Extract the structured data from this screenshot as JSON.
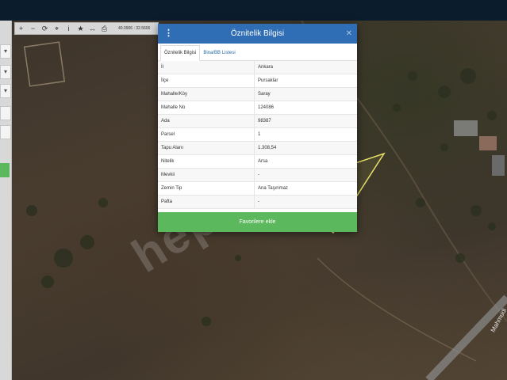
{
  "dialog": {
    "title": "Öznitelik Bilgisi",
    "tabs": [
      {
        "label": "Öznitelik Bilgisi",
        "active": true
      },
      {
        "label": "Bina/BB Listesi",
        "active": false
      }
    ],
    "rows": [
      {
        "key": "İl",
        "value": "Ankara"
      },
      {
        "key": "İlçe",
        "value": "Pursaklar"
      },
      {
        "key": "Mahalle/Köy",
        "value": "Saray"
      },
      {
        "key": "Mahalle No",
        "value": "124086"
      },
      {
        "key": "Ada",
        "value": "98387"
      },
      {
        "key": "Parsel",
        "value": "1"
      },
      {
        "key": "Tapu Alanı",
        "value": "1.308,54"
      },
      {
        "key": "Nitelik",
        "value": "Arsa"
      },
      {
        "key": "Mevkii",
        "value": "-"
      },
      {
        "key": "Zemin Tip",
        "value": "Ana Taşınmaz"
      },
      {
        "key": "Pafta",
        "value": "-"
      }
    ],
    "favorite_button": "Favorilere ekle"
  },
  "toolbar": {
    "icons": [
      "plus-icon",
      "minus-icon",
      "refresh-icon",
      "crosshair-icon",
      "info-icon",
      "star-icon",
      "measure-icon",
      "print-icon"
    ],
    "coordinates": "40.0906 : 32.5606"
  },
  "map": {
    "watermark": "hepsi",
    "road_label": "Mahmudi"
  },
  "colors": {
    "header": "#2f6db5",
    "favorite_button": "#5cb85c",
    "parcel_outline": "#e8e06a"
  }
}
